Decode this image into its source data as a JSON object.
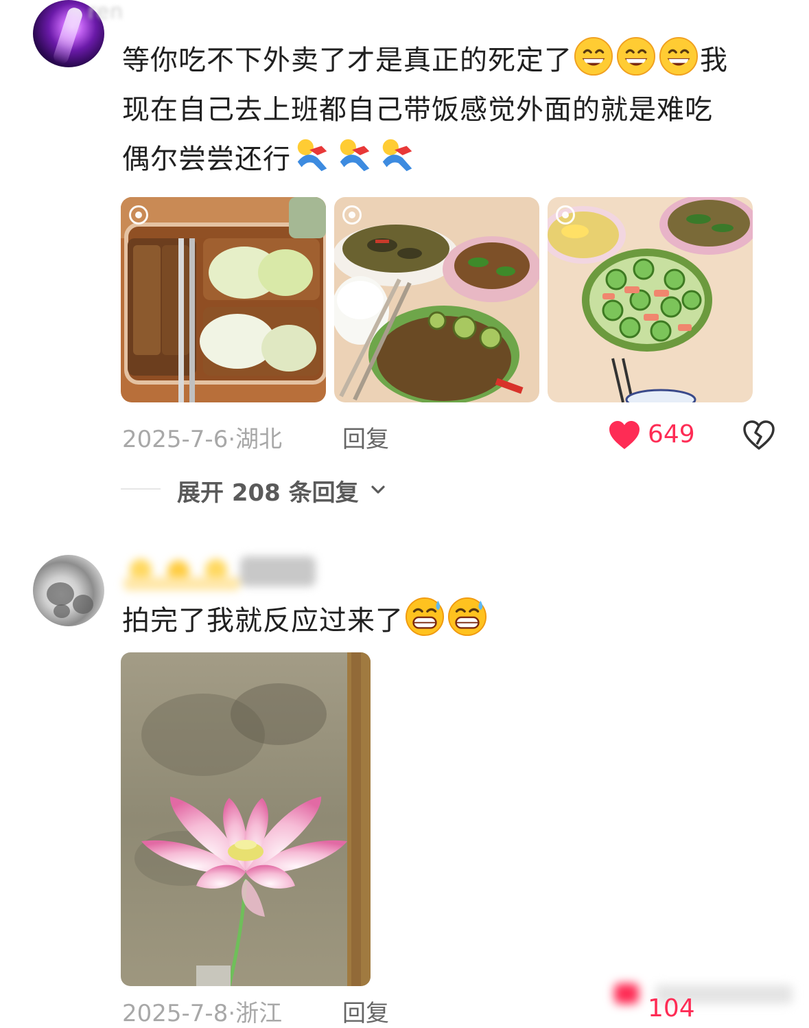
{
  "comments": [
    {
      "username": "ren",
      "text_line1": "等你吃不下外卖了才是真正的死定了",
      "text_line1_tail": "我",
      "text_line2": "现在自己去上班都自己带饭感觉外面的就是难吃",
      "text_line3": "偶尔尝尝还行",
      "emoji_line1": [
        "grin-emoji",
        "grin-emoji",
        "grin-emoji"
      ],
      "emoji_line3": [
        "falling-person-emoji",
        "falling-person-emoji",
        "falling-person-emoji"
      ],
      "photos": [
        "lunchbox-photo",
        "home-dishes-photo",
        "cucumber-salad-photo"
      ],
      "date": "2025-7-6",
      "location": "湖北",
      "date_location_separator": "·",
      "reply_label": "回复",
      "like_count": "649",
      "expand_label": "展开 208 条回复"
    },
    {
      "text": "拍完了我就反应过来了",
      "emoji": [
        "grin-sweat-emoji",
        "grin-sweat-emoji"
      ],
      "photo": "lotus-flower-photo",
      "date": "2025-7-8",
      "location": "浙江",
      "date_location_separator": "·",
      "reply_label": "回复",
      "like_count": "104"
    }
  ],
  "colors": {
    "like_red": "#fe2c55",
    "meta_gray": "#a8a8a8",
    "text_dark": "#202020"
  }
}
